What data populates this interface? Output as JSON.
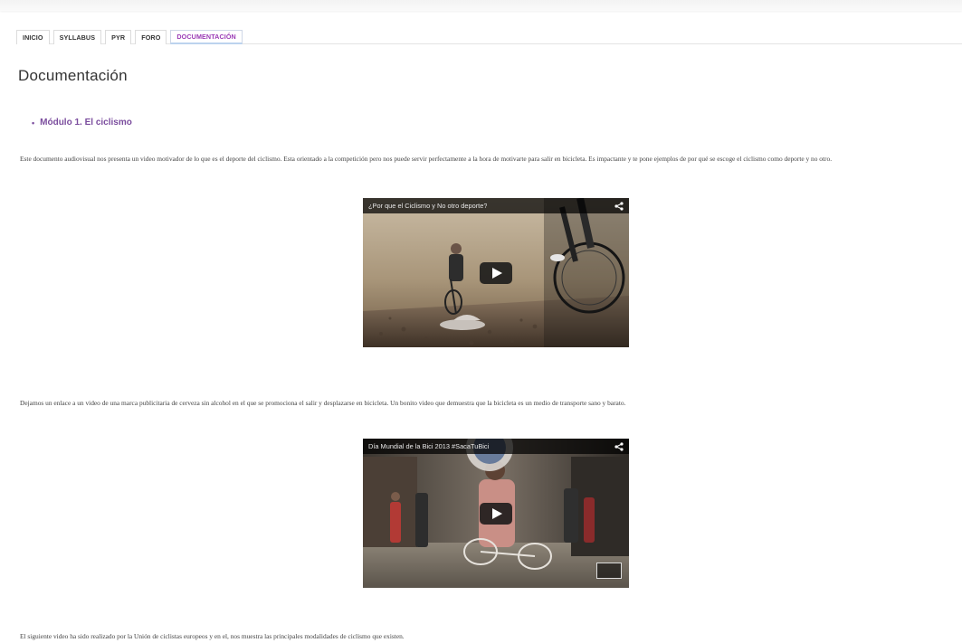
{
  "tabs": [
    {
      "label": "INICIO"
    },
    {
      "label": "SYLLABUS"
    },
    {
      "label": "PYR"
    },
    {
      "label": "FORO"
    },
    {
      "label": "DOCUMENTACIÓN",
      "active": true
    }
  ],
  "page_title": "Documentación",
  "module": {
    "title": "Módulo 1. El ciclismo"
  },
  "paragraphs": [
    "Este documento audiovisual nos presenta un video motivador de lo que es el deporte del ciclismo. Esta orientado a la competición pero nos puede servir perfectamente a la hora de motivarte para salir en bicicleta. Es impactante y te pone ejemplos de por qué se escoge el ciclismo como deporte y no otro.",
    "Dejamos un enlace a un video de una marca publicitaria de cerveza sin alcohol en el que se promociona el salir y desplazarse en bicicleta. Un bonito video que demuestra que la bicicleta es un medio de transporte sano y barato.",
    "El siguiente video ha sido realizado por la Unión de ciclistas europeos y en el, nos muestra las principales modalidades de ciclismo que existen."
  ],
  "videos": [
    {
      "title": "¿Por que el Ciclismo y No otro deporte?"
    },
    {
      "title": "Día Mundial de la Bici 2013 #SacaTuBici"
    }
  ],
  "colors": {
    "accent": "#9b3bb5",
    "module": "#7b4d9e"
  },
  "icons": {
    "share": "share-icon",
    "play": "play-icon"
  }
}
